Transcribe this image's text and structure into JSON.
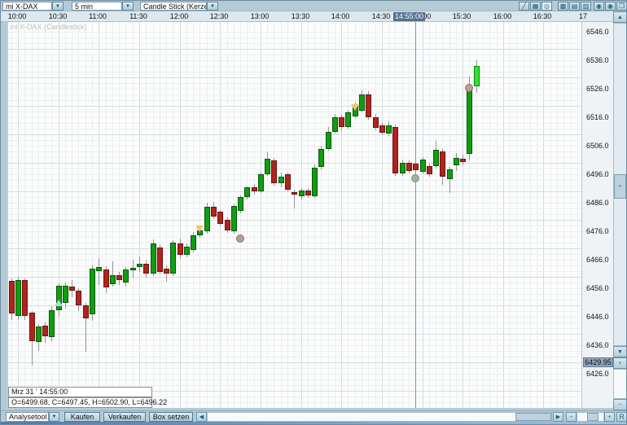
{
  "toolbar": {
    "symbol": "mi X-DAX",
    "interval": "5 min",
    "chart_type": "Candle Stick (Kerze",
    "dropdown_arrow": "▼",
    "icons": [
      {
        "name": "trendline-tool-icon",
        "glyph": "╱"
      },
      {
        "name": "grid-table-icon",
        "glyph": "▦"
      },
      {
        "name": "circle-tool-icon",
        "glyph": "◎"
      },
      {
        "name": "layout-dense-grid-icon",
        "glyph": "▩"
      },
      {
        "name": "layout-rows-icon",
        "glyph": "▤"
      },
      {
        "name": "layout-dotted-grid-icon",
        "glyph": "▥"
      },
      {
        "name": "indicator-a-icon",
        "glyph": "◉"
      },
      {
        "name": "indicator-b-icon",
        "glyph": "◉"
      },
      {
        "name": "cascade-windows-icon",
        "glyph": "❐"
      }
    ]
  },
  "watermark": "mi X-DAX (Candlestick)",
  "time_axis": {
    "ticks": [
      {
        "text": "10:00",
        "minutes": 0
      },
      {
        "text": "10:30",
        "minutes": 30
      },
      {
        "text": "11:00",
        "minutes": 60
      },
      {
        "text": "11:30",
        "minutes": 90
      },
      {
        "text": "12:00",
        "minutes": 120
      },
      {
        "text": "12:30",
        "minutes": 150
      },
      {
        "text": "13:00",
        "minutes": 180
      },
      {
        "text": "13:30",
        "minutes": 210
      },
      {
        "text": "14:00",
        "minutes": 240
      },
      {
        "text": "14:30",
        "minutes": 270
      },
      {
        "text": "15:00",
        "minutes": 300
      },
      {
        "text": "15:30",
        "minutes": 330
      },
      {
        "text": "16:00",
        "minutes": 360
      },
      {
        "text": "16:30",
        "minutes": 390
      },
      {
        "text": "17",
        "minutes": 420
      }
    ],
    "selected_label": "14:55:00",
    "selected_minutes": 295
  },
  "price_axis": {
    "labels": [
      6546.0,
      6536.0,
      6526.0,
      6516.0,
      6506.0,
      6496.0,
      6486.0,
      6476.0,
      6466.0,
      6456.0,
      6446.0,
      6436.0,
      6426.0
    ],
    "current_price": "6429.95",
    "current_price_value": 6429.95
  },
  "tooltip": {
    "line1": "Mrz 31 ' 14:55:00",
    "line2": "O=6499.68, C=6497.45, H=6502.90, L=6496.22"
  },
  "bottom_bar": {
    "analysetool": "Analysetool",
    "dropdown_arrow": "▼",
    "kaufen": "Kaufen",
    "verkaufen": "Verkaufen",
    "box_setzen": "Box setzen",
    "reset": "R"
  },
  "scroll": {
    "up": "▲",
    "down": "▼",
    "left": "◀",
    "right": "▶",
    "minus": "−",
    "plus": "+",
    "grip": "≡"
  },
  "colors": {
    "up": "#0f9e0f",
    "up_current": "#35e135",
    "down": "#b0241e",
    "wick": "#8f9496",
    "selection_line": "#8495bb",
    "time_highlight_bg": "#54718f",
    "price_highlight_bg": "#94a6ba",
    "window_bg": "#b6cad6",
    "chart_bg": "#fbfcfc"
  },
  "chart_data": {
    "type": "candlestick",
    "symbol": "mi X-DAX",
    "interval": "5 min",
    "x_axis": {
      "start": "09:55",
      "end": "17:00",
      "major_gridline_step_min": 30,
      "minor_gridline_step_min": 5
    },
    "y_axis": {
      "min": 6414,
      "max": 6549,
      "tick_step": 10,
      "minor_step": 2
    },
    "selected_time": "14:55",
    "selected_candle": {
      "time": "14:55",
      "open": 6499.68,
      "close": 6497.45,
      "high": 6502.9,
      "low": 6496.22
    },
    "current_price": 6429.95,
    "candle_format": [
      "time",
      "open",
      "high",
      "low",
      "close"
    ],
    "candles": [
      [
        "09:55",
        6458.5,
        6459.5,
        6445.0,
        6447.0
      ],
      [
        "10:00",
        6446.4,
        6460.0,
        6445.0,
        6458.9
      ],
      [
        "10:05",
        6458.9,
        6459.5,
        6444.9,
        6446.4
      ],
      [
        "10:10",
        6447.4,
        6448.0,
        6428.9,
        6437.4
      ],
      [
        "10:15",
        6437.1,
        6443.5,
        6434.0,
        6442.6
      ],
      [
        "10:20",
        6442.9,
        6444.0,
        6437.0,
        6439.1
      ],
      [
        "10:25",
        6438.9,
        6449.7,
        6437.4,
        6448.3
      ],
      [
        "10:30",
        6448.3,
        6457.7,
        6446.0,
        6456.9
      ],
      [
        "10:35",
        6451.0,
        6458.0,
        6449.0,
        6457.0
      ],
      [
        "10:40",
        6456.6,
        6459.0,
        6452.9,
        6455.1
      ],
      [
        "10:45",
        6455.1,
        6456.0,
        6448.0,
        6450.0
      ],
      [
        "10:50",
        6450.0,
        6450.9,
        6433.7,
        6445.4
      ],
      [
        "10:55",
        6447.0,
        6464.0,
        6444.6,
        6463.0
      ],
      [
        "11:00",
        6462.0,
        6466.3,
        6457.1,
        6463.4
      ],
      [
        "11:05",
        6462.6,
        6463.7,
        6454.3,
        6456.3
      ],
      [
        "11:10",
        6457.4,
        6465.4,
        6456.6,
        6460.6
      ],
      [
        "11:15",
        6460.6,
        6461.7,
        6457.1,
        6458.9
      ],
      [
        "11:20",
        6458.0,
        6463.4,
        6456.6,
        6462.6
      ],
      [
        "11:25",
        6462.3,
        6466.0,
        6459.7,
        6463.1
      ],
      [
        "11:30",
        6463.4,
        6467.1,
        6461.7,
        6464.6
      ],
      [
        "11:35",
        6464.6,
        6465.7,
        6459.7,
        6461.1
      ],
      [
        "11:40",
        6461.1,
        6473.1,
        6460.3,
        6471.7
      ],
      [
        "11:45",
        6470.3,
        6471.4,
        6460.9,
        6461.7
      ],
      [
        "11:50",
        6463.0,
        6464.0,
        6458.3,
        6461.4
      ],
      [
        "11:55",
        6461.1,
        6472.9,
        6460.3,
        6472.0
      ],
      [
        "12:00",
        6471.7,
        6473.4,
        6466.3,
        6467.7
      ],
      [
        "12:05",
        6467.7,
        6471.7,
        6466.9,
        6470.6
      ],
      [
        "12:10",
        6469.4,
        6475.7,
        6468.6,
        6474.5
      ],
      [
        "12:15",
        6474.5,
        6477.4,
        6473.7,
        6476.3
      ],
      [
        "12:20",
        6476.0,
        6486.0,
        6475.1,
        6484.5
      ],
      [
        "12:25",
        6484.5,
        6486.3,
        6480.3,
        6481.1
      ],
      [
        "12:30",
        6482.9,
        6483.4,
        6478.0,
        6478.6
      ],
      [
        "12:35",
        6480.0,
        6480.9,
        6475.4,
        6476.3
      ],
      [
        "12:40",
        6476.0,
        6485.4,
        6475.1,
        6484.9
      ],
      [
        "12:45",
        6483.1,
        6488.6,
        6482.3,
        6488.0
      ],
      [
        "12:50",
        6488.0,
        6491.7,
        6487.1,
        6491.4
      ],
      [
        "12:55",
        6491.4,
        6492.6,
        6488.9,
        6490.0
      ],
      [
        "13:00",
        6490.0,
        6496.6,
        6489.4,
        6496.0
      ],
      [
        "13:05",
        6496.0,
        6503.7,
        6495.4,
        6501.4
      ],
      [
        "13:10",
        6500.9,
        6501.7,
        6492.0,
        6492.9
      ],
      [
        "13:15",
        6492.9,
        6496.6,
        6491.4,
        6495.1
      ],
      [
        "13:20",
        6496.0,
        6496.6,
        6489.9,
        6490.6
      ],
      [
        "13:25",
        6489.7,
        6490.6,
        6483.9,
        6488.9
      ],
      [
        "13:30",
        6488.3,
        6491.1,
        6487.1,
        6490.3
      ],
      [
        "13:35",
        6490.3,
        6491.1,
        6487.7,
        6488.6
      ],
      [
        "13:40",
        6488.3,
        6499.4,
        6487.7,
        6498.3
      ],
      [
        "13:45",
        6498.6,
        6506.0,
        6497.7,
        6505.0
      ],
      [
        "13:50",
        6505.0,
        6512.6,
        6504.3,
        6511.0
      ],
      [
        "13:55",
        6511.0,
        6517.1,
        6510.3,
        6516.0
      ],
      [
        "14:00",
        6516.0,
        6516.9,
        6511.4,
        6512.6
      ],
      [
        "14:05",
        6512.6,
        6518.6,
        6512.0,
        6517.7
      ],
      [
        "14:10",
        6516.3,
        6521.1,
        6515.7,
        6520.0
      ],
      [
        "14:15",
        6518.3,
        6525.4,
        6517.7,
        6524.0
      ],
      [
        "14:20",
        6524.0,
        6525.1,
        6515.1,
        6516.0
      ],
      [
        "14:25",
        6516.0,
        6517.1,
        6511.4,
        6512.3
      ],
      [
        "14:30",
        6513.1,
        6514.0,
        6509.7,
        6510.6
      ],
      [
        "14:35",
        6510.3,
        6514.6,
        6509.4,
        6513.1
      ],
      [
        "14:40",
        6512.6,
        6513.4,
        6495.4,
        6496.3
      ],
      [
        "14:45",
        6496.3,
        6501.1,
        6495.4,
        6500.0
      ],
      [
        "14:50",
        6500.0,
        6500.9,
        6496.3,
        6497.1
      ],
      [
        "14:55",
        6499.68,
        6502.9,
        6496.22,
        6497.45
      ],
      [
        "15:00",
        6496.9,
        6502.0,
        6496.0,
        6501.1
      ],
      [
        "15:05",
        6498.9,
        6499.7,
        6495.1,
        6496.0
      ],
      [
        "15:10",
        6498.9,
        6507.7,
        6498.0,
        6504.6
      ],
      [
        "15:15",
        6504.0,
        6504.9,
        6492.3,
        6495.1
      ],
      [
        "15:20",
        6494.3,
        6498.6,
        6489.4,
        6497.7
      ],
      [
        "15:25",
        6499.1,
        6503.4,
        6497.1,
        6501.7
      ],
      [
        "15:30",
        6501.4,
        6502.9,
        6499.1,
        6500.3
      ],
      [
        "15:35",
        6503.1,
        6530.3,
        6500.9,
        6525.4
      ],
      [
        "15:40",
        6526.9,
        6536.1,
        6524.6,
        6534.0
      ]
    ],
    "markers": [
      {
        "time": "10:30",
        "price": 6451.0,
        "shape": "triangle-up",
        "color": "#a6d9ec",
        "border": "#4a88a8",
        "name": "buy-signal-marker"
      },
      {
        "time": "12:15",
        "price": 6477.0,
        "shape": "triangle-down",
        "color": "#f3c46e",
        "border": "#b8860b",
        "name": "sell-signal-marker"
      },
      {
        "time": "14:10",
        "price": 6519.3,
        "shape": "triangle-down",
        "color": "#f3c46e",
        "border": "#b8860b",
        "name": "sell-signal-marker"
      },
      {
        "time": "12:45",
        "price": 6473.5,
        "shape": "circle",
        "color": "#b59c98",
        "border": "#8d7672",
        "name": "trade-dot-marker"
      },
      {
        "time": "14:55",
        "price": 6494.6,
        "shape": "circle",
        "color": "#9cb49c",
        "border": "#7a967a",
        "name": "trade-dot-marker"
      },
      {
        "time": "15:35",
        "price": 6526.2,
        "shape": "circle",
        "color": "#bd9c9c",
        "border": "#927272",
        "name": "trade-dot-marker"
      }
    ]
  }
}
